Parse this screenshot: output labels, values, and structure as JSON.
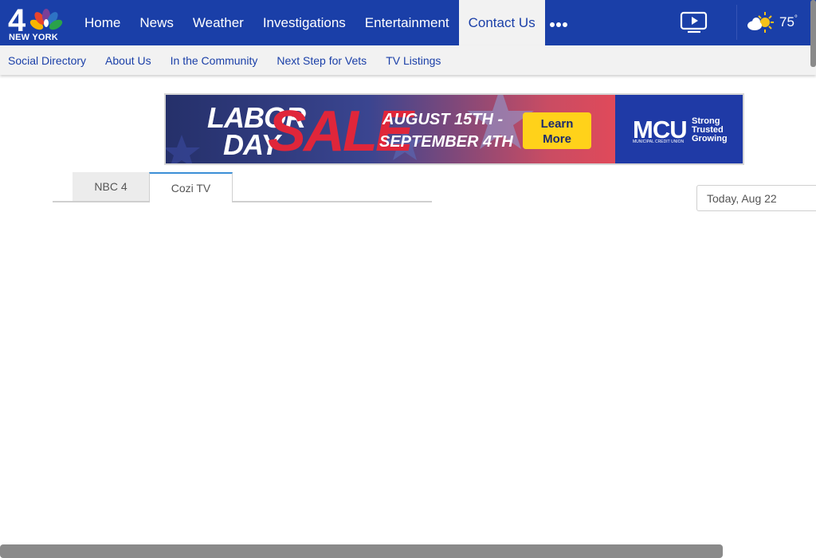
{
  "header": {
    "logo_text": "NEW YORK",
    "nav": [
      "Home",
      "News",
      "Weather",
      "Investigations",
      "Entertainment",
      "Contact Us"
    ],
    "active_nav": "Contact Us",
    "temperature": "75",
    "degree_symbol": "°"
  },
  "subnav": [
    "Social Directory",
    "About Us",
    "In the Community",
    "Next Step for Vets",
    "TV Listings"
  ],
  "ad": {
    "line1": "LABOR",
    "line2": "DAY",
    "sale": "SALE",
    "date1": "AUGUST 15TH -",
    "date2": "SEPTEMBER 4TH",
    "button_line1": "Learn",
    "button_line2": "More",
    "brand": "MCU",
    "brand_sub": "MUNICIPAL CREDIT UNION",
    "tagline1": "Strong",
    "tagline2": "Trusted",
    "tagline3": "Growing"
  },
  "tabs": [
    "NBC 4",
    "Cozi TV"
  ],
  "selected_tab": "Cozi TV",
  "date_picker": {
    "value": "Today, Aug 22"
  },
  "colors": {
    "nav_blue": "#1a3fa8",
    "sale_red": "#e0263a",
    "button_yellow": "#ffd21a"
  }
}
